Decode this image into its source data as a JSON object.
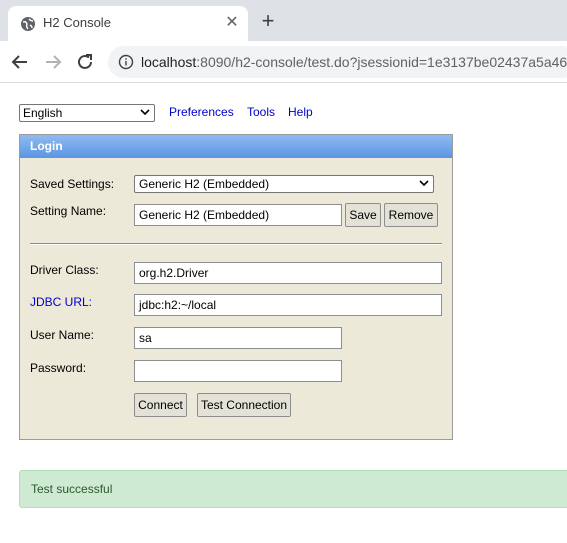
{
  "browser": {
    "tab_title": "H2 Console",
    "url_host": "localhost",
    "url_rest": ":8090/h2-console/test.do?jsessionid=1e3137be02437a5a46"
  },
  "topbar": {
    "language": "English",
    "links": [
      "Preferences",
      "Tools",
      "Help"
    ]
  },
  "login": {
    "header": "Login",
    "saved_settings_label": "Saved Settings:",
    "saved_settings_value": "Generic H2 (Embedded)",
    "setting_name_label": "Setting Name:",
    "setting_name_value": "Generic H2 (Embedded)",
    "save_label": "Save",
    "remove_label": "Remove",
    "driver_class_label": "Driver Class:",
    "driver_class_value": "org.h2.Driver",
    "jdbc_url_label": "JDBC URL:",
    "jdbc_url_value": "jdbc:h2:~/local",
    "user_name_label": "User Name:",
    "user_name_value": "sa",
    "password_label": "Password:",
    "password_value": "",
    "connect_label": "Connect",
    "test_connection_label": "Test Connection"
  },
  "status": {
    "message": "Test successful"
  },
  "colors": {
    "panel_bg": "#ece9d8",
    "header_blue": "#5b95e2",
    "link_blue": "#0000cc",
    "success_bg": "#cfead3"
  }
}
